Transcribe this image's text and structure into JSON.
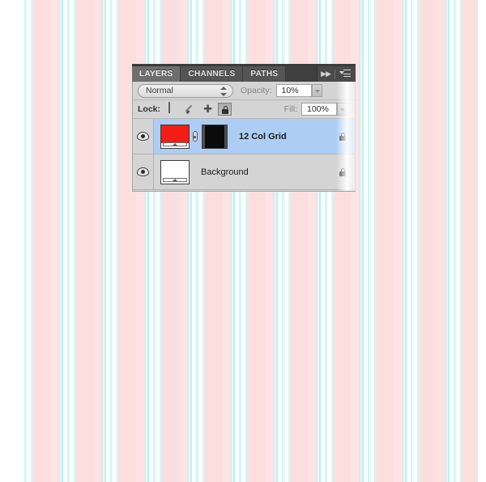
{
  "panel": {
    "name": "Layers Panel",
    "tabs": [
      {
        "label": "LAYERS",
        "active": true
      },
      {
        "label": "CHANNELS",
        "active": false
      },
      {
        "label": "PATHS",
        "active": false
      }
    ],
    "controls": {
      "collapse_icon": "double-chevron-right-icon",
      "menu_icon": "panel-menu-icon"
    },
    "blend_mode": {
      "label": "Normal",
      "stepper_icon": "stepper-arrows-icon"
    },
    "opacity": {
      "label": "Opacity:",
      "value": "10%",
      "dropdown_icon": "chevron-down-icon"
    },
    "lock": {
      "label": "Lock:",
      "buttons": [
        {
          "name": "lock-transparent-pixels",
          "icon": "checkerboard-icon",
          "active": false
        },
        {
          "name": "lock-image-pixels",
          "icon": "paintbrush-icon",
          "active": false
        },
        {
          "name": "lock-position",
          "icon": "move-cross-icon",
          "active": false
        },
        {
          "name": "lock-all",
          "icon": "padlock-icon",
          "active": true
        }
      ]
    },
    "fill": {
      "label": "Fill:",
      "value": "100%",
      "dropdown_icon": "chevron-down-icon"
    },
    "layers": [
      {
        "name": "12 Col Grid",
        "visible": true,
        "selected": true,
        "locked": true,
        "thumbnail_color": "#f21d14",
        "has_mask": true,
        "mask_color": "#0b0b0b",
        "linked": true
      },
      {
        "name": "Background",
        "visible": true,
        "selected": false,
        "locked": true,
        "thumbnail_color": "#ffffff",
        "has_mask": false,
        "linked": false
      }
    ]
  },
  "colors": {
    "panel_background": "#d4d4d4",
    "tab_bar": "#4a4a4a",
    "selection_blue": "#aecdf5",
    "wallpaper_pink": "#fcdede",
    "wallpaper_cyan": "#b8f2f4",
    "wallpaper_white": "#ffffff"
  }
}
